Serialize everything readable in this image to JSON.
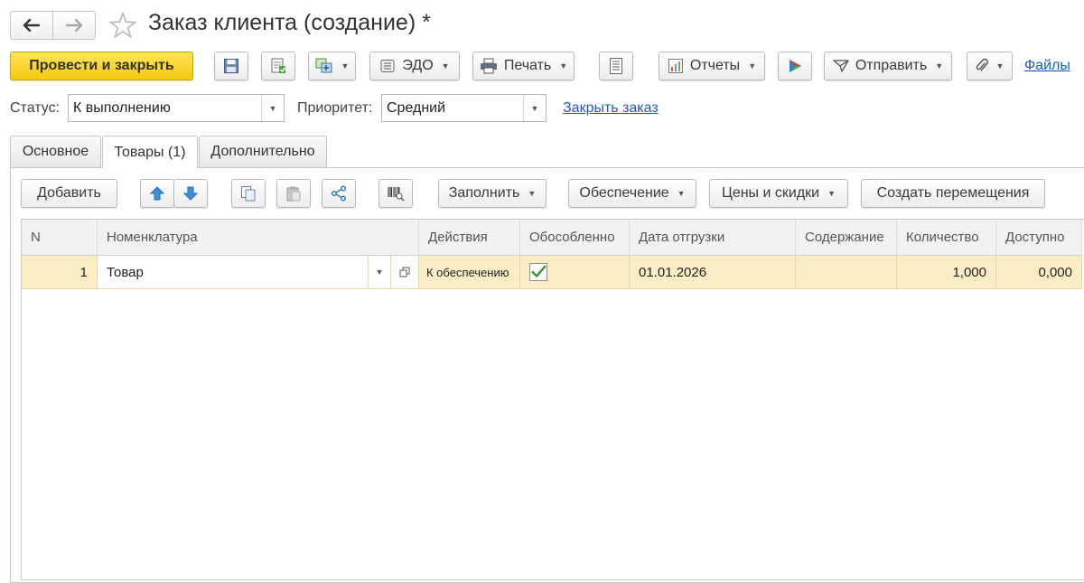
{
  "window": {
    "title": "Заказ клиента (создание) *"
  },
  "toolbar": {
    "post_and_close": "Провести и закрыть",
    "edo": "ЭДО",
    "print": "Печать",
    "reports": "Отчеты",
    "send": "Отправить",
    "files": "Файлы"
  },
  "header_fields": {
    "status_label": "Статус:",
    "status_value": "К выполнению",
    "priority_label": "Приоритет:",
    "priority_value": "Средний",
    "close_order_link": "Закрыть заказ"
  },
  "tabs": [
    {
      "label": "Основное"
    },
    {
      "label": "Товары (1)"
    },
    {
      "label": "Дополнительно"
    }
  ],
  "goods_toolbar": {
    "add": "Добавить",
    "fill": "Заполнить",
    "provision": "Обеспечение",
    "prices": "Цены и скидки",
    "create_transfers": "Создать перемещения"
  },
  "table": {
    "columns": [
      "N",
      "Номенклатура",
      "Действия",
      "Обособленно",
      "Дата отгрузки",
      "Содержание",
      "Количество",
      "Доступно"
    ],
    "rows": [
      {
        "n": "1",
        "item": "Товар",
        "action": "К обеспечению",
        "separate": true,
        "ship_date": "01.01.2026",
        "content": "",
        "quantity": "1,000",
        "available": "0,000"
      }
    ]
  },
  "colors": {
    "primary_button": "#f5cb0c",
    "selected_row": "#fbeec4",
    "link": "#1d5bbf",
    "check": "#2e9a2e"
  }
}
